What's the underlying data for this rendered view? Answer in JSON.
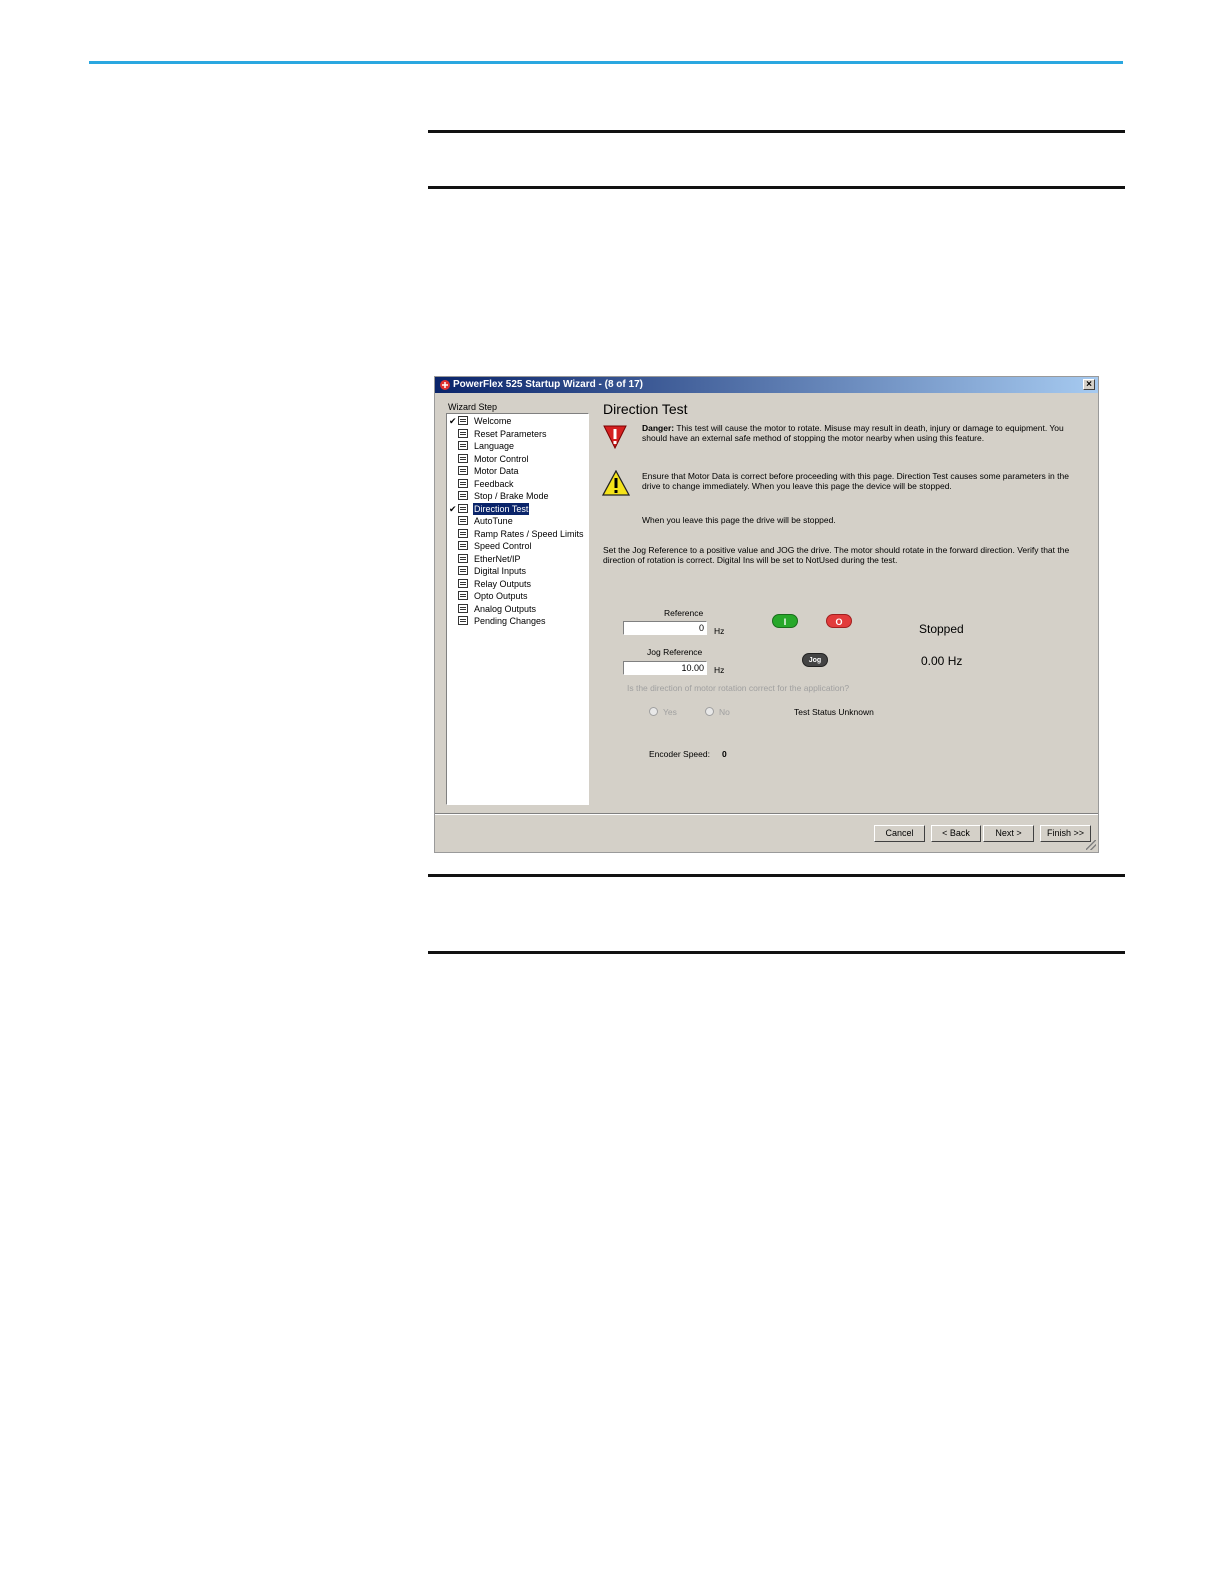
{
  "window": {
    "title": "PowerFlex 525 Startup Wizard - (8 of 17)",
    "close_label": "×"
  },
  "sidebar": {
    "label": "Wizard Step",
    "items": [
      {
        "label": "Welcome",
        "checked": true
      },
      {
        "label": "Reset Parameters",
        "checked": false
      },
      {
        "label": "Language",
        "checked": false
      },
      {
        "label": "Motor Control",
        "checked": false
      },
      {
        "label": "Motor Data",
        "checked": false
      },
      {
        "label": "Feedback",
        "checked": false
      },
      {
        "label": "Stop / Brake Mode",
        "checked": false
      },
      {
        "label": "Direction Test",
        "checked": true,
        "selected": true
      },
      {
        "label": "AutoTune",
        "checked": false
      },
      {
        "label": "Ramp Rates / Speed Limits",
        "checked": false
      },
      {
        "label": "Speed Control",
        "checked": false
      },
      {
        "label": "EtherNet/IP",
        "checked": false
      },
      {
        "label": "Digital Inputs",
        "checked": false
      },
      {
        "label": "Relay Outputs",
        "checked": false
      },
      {
        "label": "Opto Outputs",
        "checked": false
      },
      {
        "label": "Analog Outputs",
        "checked": false
      },
      {
        "label": "Pending Changes",
        "checked": false
      }
    ]
  },
  "main": {
    "title": "Direction Test",
    "danger_label": "Danger:",
    "danger_text": " This test will cause the motor to rotate.  Misuse may result in death, injury or damage to equipment.  You should have an external safe method of stopping the motor nearby when using this feature.",
    "caution_text": "Ensure that Motor Data is correct before proceeding with this page. Direction Test causes some parameters in the drive to change immediately. When you leave this page the device will be stopped.",
    "leave_note": "When you leave this page the drive will be stopped.",
    "instructions": "Set the Jog Reference to a positive value and JOG the drive.  The motor should rotate in the forward direction.  Verify that the direction of rotation is correct. Digital Ins will be set to NotUsed during the test.",
    "reference_label": "Reference",
    "reference_value": "0",
    "reference_unit": "Hz",
    "jog_reference_label": "Jog Reference",
    "jog_reference_value": "10.00",
    "jog_reference_unit": "Hz",
    "start_button": "I",
    "stop_button": "O",
    "jog_button": "Jog",
    "drive_status": "Stopped",
    "drive_frequency": "0.00 Hz",
    "question": "Is the direction of motor rotation correct for the application?",
    "yes_label": "Yes",
    "no_label": "No",
    "test_status": "Test Status Unknown",
    "encoder_label": "Encoder Speed:",
    "encoder_value": "0"
  },
  "footer": {
    "cancel": "Cancel",
    "back": "< Back",
    "next": "Next >",
    "finish": "Finish >>"
  },
  "colors": {
    "accent_rule": "#2aa7e0",
    "title_gradient_start": "#0a246a",
    "dialog_bg": "#d4d0c8",
    "start_green": "#27a82a",
    "stop_red": "#e23b3b"
  }
}
